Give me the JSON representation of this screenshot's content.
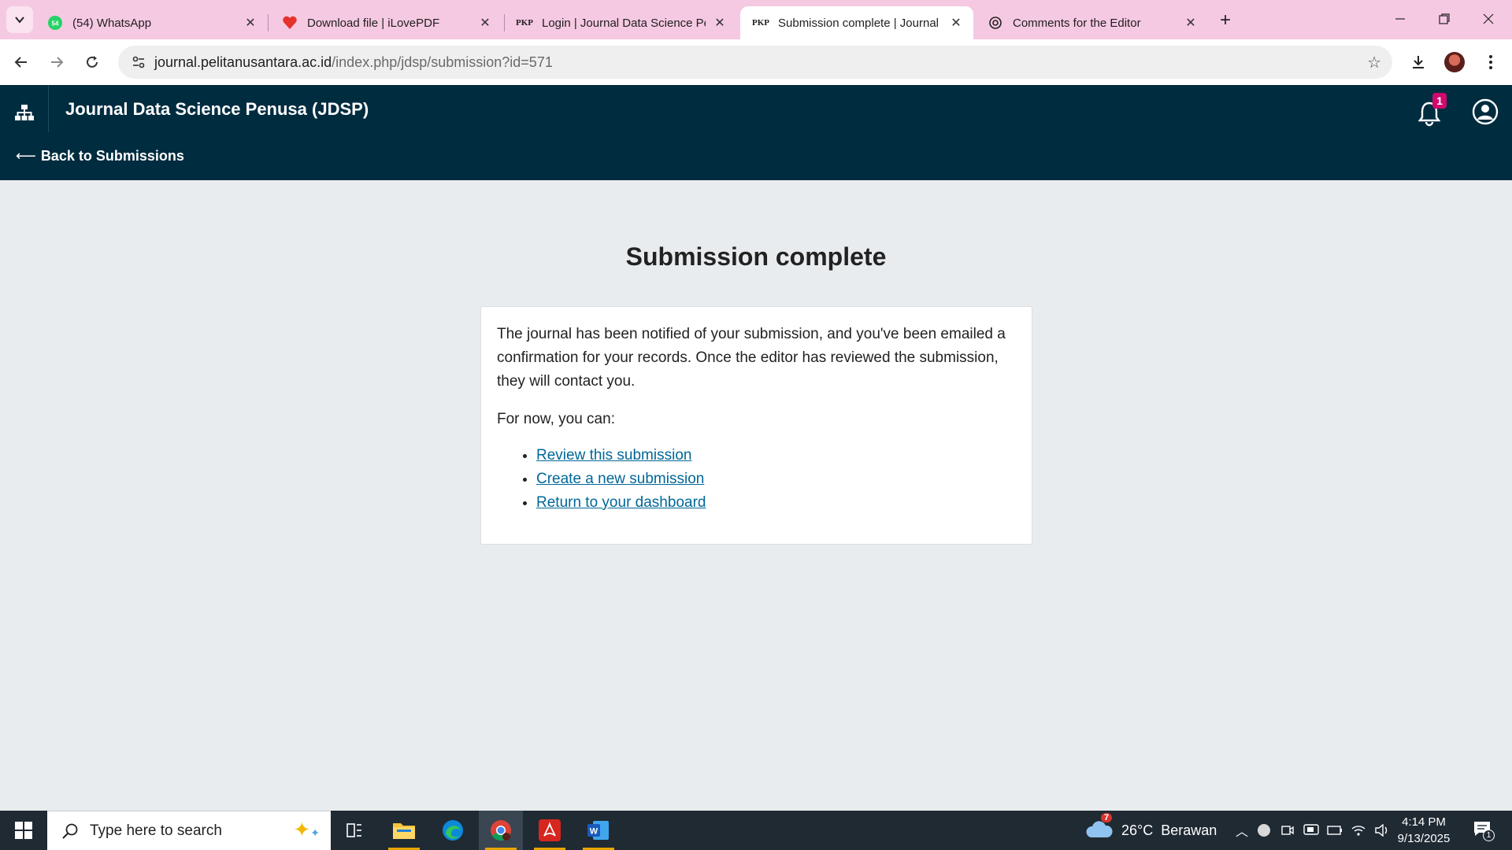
{
  "browser": {
    "tabs": [
      {
        "title": "(54) WhatsApp",
        "icon": "whatsapp-icon",
        "badge": "54"
      },
      {
        "title": "Download file | iLovePDF",
        "icon": "ilovepdf-heart-icon"
      },
      {
        "title": "Login | Journal Data Science Pen",
        "icon": "pkp-icon",
        "icon_text": "PKP"
      },
      {
        "title": "Submission complete | Journal",
        "icon": "pkp-icon",
        "icon_text": "PKP",
        "active": true
      },
      {
        "title": "Comments for the Editor",
        "icon": "openai-icon"
      }
    ],
    "url_host": "journal.pelitanusantara.ac.id",
    "url_path": "/index.php/jdsp/submission?id=571"
  },
  "header": {
    "journal_title": "Journal Data Science Penusa (JDSP)",
    "notification_count": "1",
    "back_label": "Back to Submissions"
  },
  "main": {
    "title": "Submission complete",
    "paragraph": "The journal has been notified of your submission, and you've been emailed a confirmation for your records. Once the editor has reviewed the submission, they will contact you.",
    "prompt": "For now, you can:",
    "links": [
      "Review this submission",
      "Create a new submission",
      "Return to your dashboard"
    ]
  },
  "taskbar": {
    "search_placeholder": "Type here to search",
    "weather_temp": "26°C",
    "weather_desc": "Berawan",
    "weather_alert": "7",
    "time": "4:14 PM",
    "date": "9/13/2025",
    "notification_count": "1"
  },
  "colors": {
    "tab_strip": "#f6c9e2",
    "header_bg": "#002c40",
    "link": "#006798",
    "badge": "#d00a6c"
  }
}
